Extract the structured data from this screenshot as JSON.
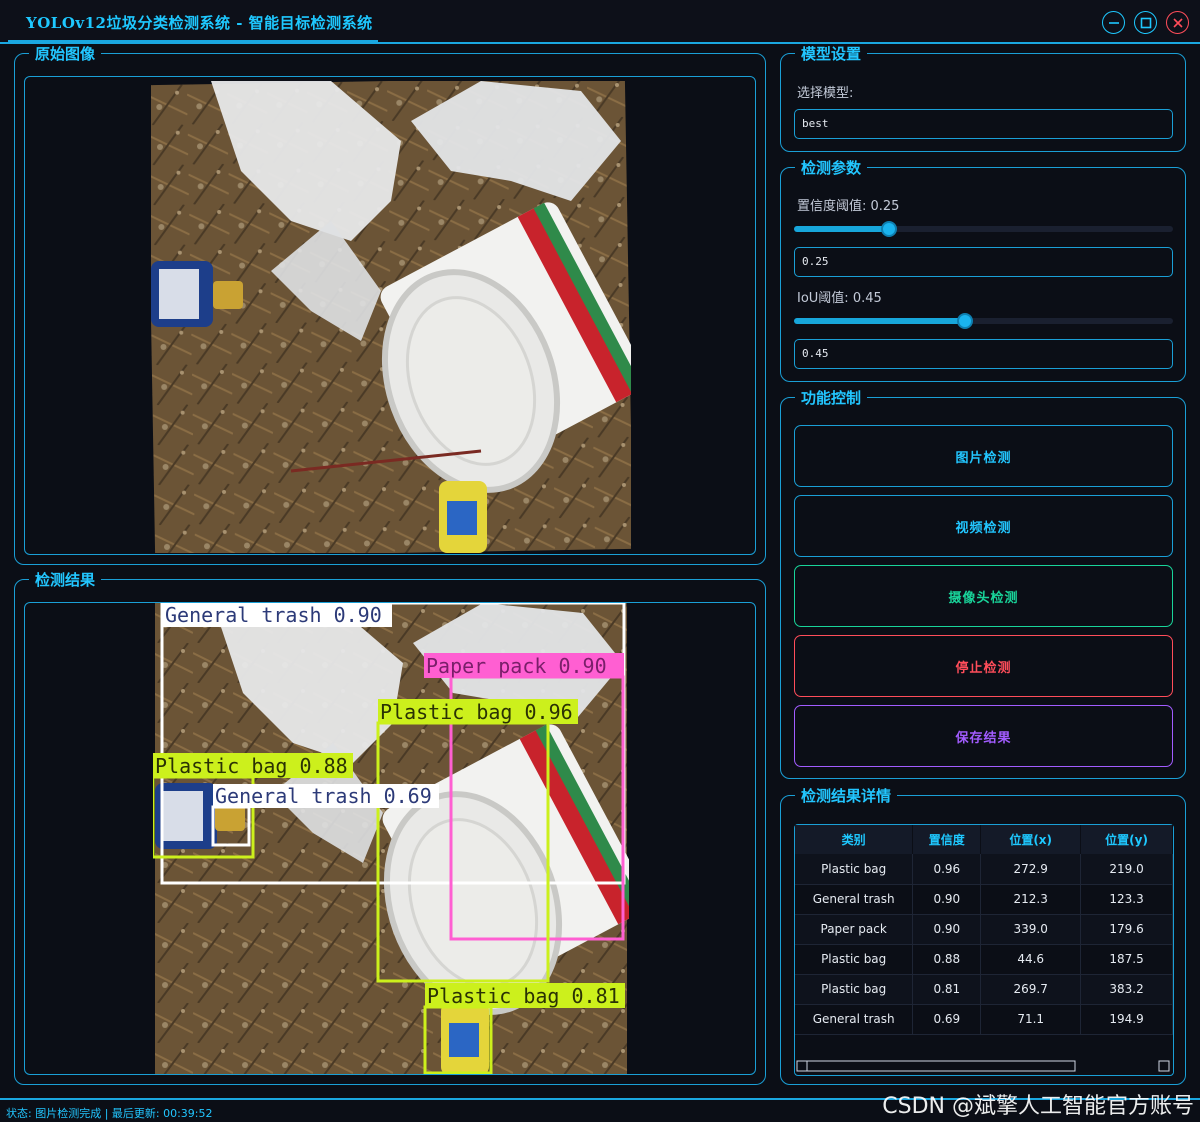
{
  "window": {
    "title": "YOLOv12垃圾分类检测系统 - 智能目标检测系统"
  },
  "original_panel": {
    "title": "原始图像"
  },
  "result_panel": {
    "title": "检测结果",
    "boxes": [
      {
        "label": "General trash 0.90",
        "color": "#ffffff",
        "text_color": "#2c3a78"
      },
      {
        "label": "Paper pack 0.90",
        "color": "#ff5fd2",
        "text_color": "#7a1f6a"
      },
      {
        "label": "Plastic bag 0.96",
        "color": "#ccf01c",
        "text_color": "#2a3204"
      },
      {
        "label": "Plastic bag 0.88",
        "color": "#ccf01c",
        "text_color": "#2a3204"
      },
      {
        "label": "General trash 0.69",
        "color": "#ffffff",
        "text_color": "#2c3a78"
      },
      {
        "label": "Plastic bag 0.81",
        "color": "#ccf01c",
        "text_color": "#2a3204"
      }
    ]
  },
  "model_settings": {
    "title": "模型设置",
    "select_label": "选择模型:",
    "selected_model": "best"
  },
  "detection_params": {
    "title": "检测参数",
    "conf_label": "置信度阈值: 0.25",
    "conf_value": "0.25",
    "conf_level": 0.25,
    "iou_label": "IoU阈值: 0.45",
    "iou_value": "0.45",
    "iou_level": 0.45
  },
  "controls": {
    "title": "功能控制",
    "image_detect": "图片检测",
    "video_detect": "视频检测",
    "camera_detect": "摄像头检测",
    "stop_detect": "停止检测",
    "save_results": "保存结果"
  },
  "details": {
    "title": "检测结果详情",
    "columns": [
      "类别",
      "置信度",
      "位置(x)",
      "位置(y)"
    ],
    "rows": [
      [
        "Plastic bag",
        "0.96",
        "272.9",
        "219.0"
      ],
      [
        "General trash",
        "0.90",
        "212.3",
        "123.3"
      ],
      [
        "Paper pack",
        "0.90",
        "339.0",
        "179.6"
      ],
      [
        "Plastic bag",
        "0.88",
        "44.6",
        "187.5"
      ],
      [
        "Plastic bag",
        "0.81",
        "269.7",
        "383.2"
      ],
      [
        "General trash",
        "0.69",
        "71.1",
        "194.9"
      ]
    ]
  },
  "status": {
    "text": "状态: 图片检测完成 | 最后更新: 00:39:52"
  },
  "watermark": "CSDN @斌擎人工智能官方账号",
  "colors": {
    "accent": "#1ec8ff",
    "border": "#1a9fd6",
    "stop": "#ff4d5a",
    "camera": "#19d49a",
    "save": "#a25cff"
  }
}
